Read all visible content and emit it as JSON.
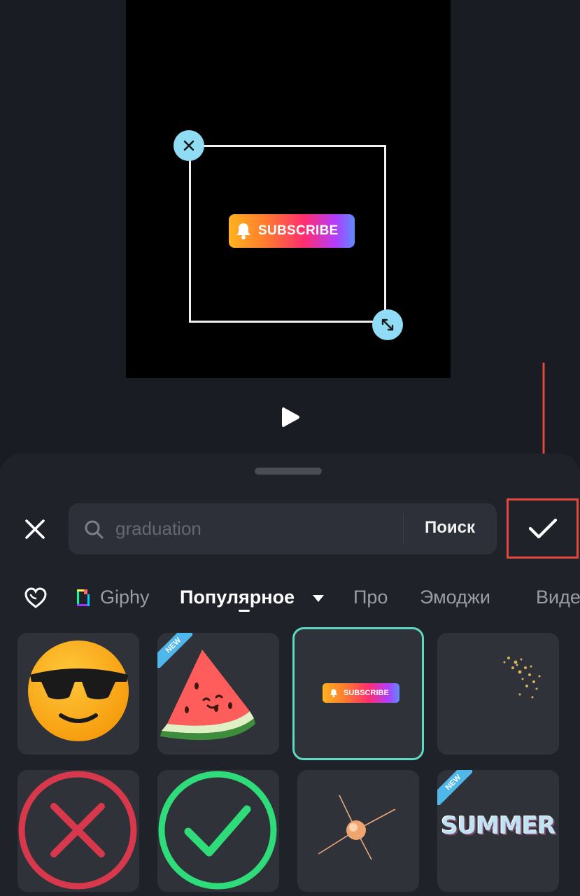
{
  "preview": {
    "sticker_text": "SUBSCRIBE"
  },
  "search": {
    "placeholder": "graduation",
    "button_label": "Поиск"
  },
  "tabs": [
    {
      "label": "Giphy"
    },
    {
      "label": "Популярное"
    },
    {
      "label": "Про"
    },
    {
      "label": "Эмоджи"
    },
    {
      "label": "Виде"
    }
  ],
  "stickers": [
    {
      "name": "sunglasses-emoji",
      "badge": ""
    },
    {
      "name": "watermelon",
      "badge": "NEW"
    },
    {
      "name": "subscribe-button",
      "badge": "",
      "text": "SUBSCRIBE"
    },
    {
      "name": "gold-sparkles",
      "badge": ""
    },
    {
      "name": "red-cross",
      "badge": ""
    },
    {
      "name": "green-check",
      "badge": ""
    },
    {
      "name": "sparkle-burst",
      "badge": ""
    },
    {
      "name": "summer-text",
      "badge": "NEW",
      "text": "SUMMER"
    }
  ],
  "colors": {
    "accent": "#5fd8c2",
    "annotation": "#e2493b",
    "handle": "#8fdcf4"
  }
}
